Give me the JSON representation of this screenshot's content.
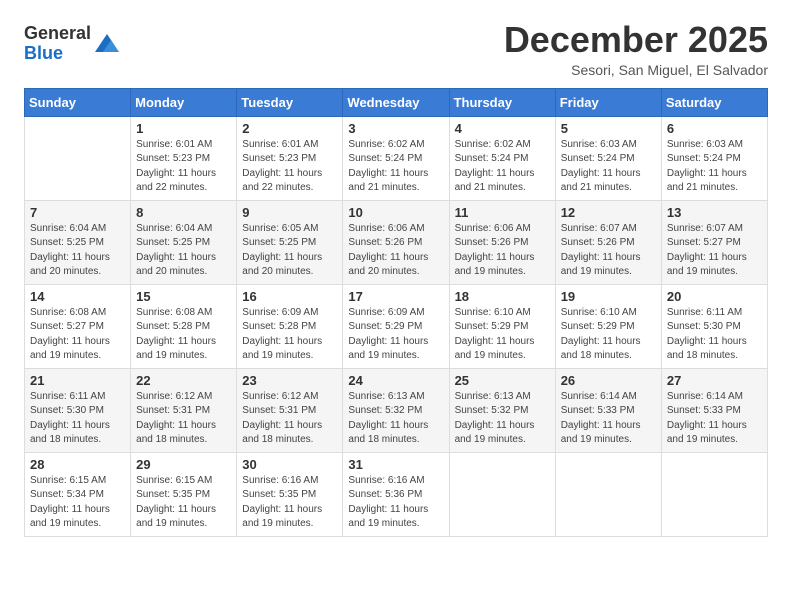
{
  "header": {
    "logo": {
      "line1": "General",
      "line2": "Blue"
    },
    "title": "December 2025",
    "subtitle": "Sesori, San Miguel, El Salvador"
  },
  "days_of_week": [
    "Sunday",
    "Monday",
    "Tuesday",
    "Wednesday",
    "Thursday",
    "Friday",
    "Saturday"
  ],
  "weeks": [
    [
      {
        "day": "",
        "info": ""
      },
      {
        "day": "1",
        "info": "Sunrise: 6:01 AM\nSunset: 5:23 PM\nDaylight: 11 hours\nand 22 minutes."
      },
      {
        "day": "2",
        "info": "Sunrise: 6:01 AM\nSunset: 5:23 PM\nDaylight: 11 hours\nand 22 minutes."
      },
      {
        "day": "3",
        "info": "Sunrise: 6:02 AM\nSunset: 5:24 PM\nDaylight: 11 hours\nand 21 minutes."
      },
      {
        "day": "4",
        "info": "Sunrise: 6:02 AM\nSunset: 5:24 PM\nDaylight: 11 hours\nand 21 minutes."
      },
      {
        "day": "5",
        "info": "Sunrise: 6:03 AM\nSunset: 5:24 PM\nDaylight: 11 hours\nand 21 minutes."
      },
      {
        "day": "6",
        "info": "Sunrise: 6:03 AM\nSunset: 5:24 PM\nDaylight: 11 hours\nand 21 minutes."
      }
    ],
    [
      {
        "day": "7",
        "info": "Sunrise: 6:04 AM\nSunset: 5:25 PM\nDaylight: 11 hours\nand 20 minutes."
      },
      {
        "day": "8",
        "info": "Sunrise: 6:04 AM\nSunset: 5:25 PM\nDaylight: 11 hours\nand 20 minutes."
      },
      {
        "day": "9",
        "info": "Sunrise: 6:05 AM\nSunset: 5:25 PM\nDaylight: 11 hours\nand 20 minutes."
      },
      {
        "day": "10",
        "info": "Sunrise: 6:06 AM\nSunset: 5:26 PM\nDaylight: 11 hours\nand 20 minutes."
      },
      {
        "day": "11",
        "info": "Sunrise: 6:06 AM\nSunset: 5:26 PM\nDaylight: 11 hours\nand 19 minutes."
      },
      {
        "day": "12",
        "info": "Sunrise: 6:07 AM\nSunset: 5:26 PM\nDaylight: 11 hours\nand 19 minutes."
      },
      {
        "day": "13",
        "info": "Sunrise: 6:07 AM\nSunset: 5:27 PM\nDaylight: 11 hours\nand 19 minutes."
      }
    ],
    [
      {
        "day": "14",
        "info": "Sunrise: 6:08 AM\nSunset: 5:27 PM\nDaylight: 11 hours\nand 19 minutes."
      },
      {
        "day": "15",
        "info": "Sunrise: 6:08 AM\nSunset: 5:28 PM\nDaylight: 11 hours\nand 19 minutes."
      },
      {
        "day": "16",
        "info": "Sunrise: 6:09 AM\nSunset: 5:28 PM\nDaylight: 11 hours\nand 19 minutes."
      },
      {
        "day": "17",
        "info": "Sunrise: 6:09 AM\nSunset: 5:29 PM\nDaylight: 11 hours\nand 19 minutes."
      },
      {
        "day": "18",
        "info": "Sunrise: 6:10 AM\nSunset: 5:29 PM\nDaylight: 11 hours\nand 19 minutes."
      },
      {
        "day": "19",
        "info": "Sunrise: 6:10 AM\nSunset: 5:29 PM\nDaylight: 11 hours\nand 18 minutes."
      },
      {
        "day": "20",
        "info": "Sunrise: 6:11 AM\nSunset: 5:30 PM\nDaylight: 11 hours\nand 18 minutes."
      }
    ],
    [
      {
        "day": "21",
        "info": "Sunrise: 6:11 AM\nSunset: 5:30 PM\nDaylight: 11 hours\nand 18 minutes."
      },
      {
        "day": "22",
        "info": "Sunrise: 6:12 AM\nSunset: 5:31 PM\nDaylight: 11 hours\nand 18 minutes."
      },
      {
        "day": "23",
        "info": "Sunrise: 6:12 AM\nSunset: 5:31 PM\nDaylight: 11 hours\nand 18 minutes."
      },
      {
        "day": "24",
        "info": "Sunrise: 6:13 AM\nSunset: 5:32 PM\nDaylight: 11 hours\nand 18 minutes."
      },
      {
        "day": "25",
        "info": "Sunrise: 6:13 AM\nSunset: 5:32 PM\nDaylight: 11 hours\nand 19 minutes."
      },
      {
        "day": "26",
        "info": "Sunrise: 6:14 AM\nSunset: 5:33 PM\nDaylight: 11 hours\nand 19 minutes."
      },
      {
        "day": "27",
        "info": "Sunrise: 6:14 AM\nSunset: 5:33 PM\nDaylight: 11 hours\nand 19 minutes."
      }
    ],
    [
      {
        "day": "28",
        "info": "Sunrise: 6:15 AM\nSunset: 5:34 PM\nDaylight: 11 hours\nand 19 minutes."
      },
      {
        "day": "29",
        "info": "Sunrise: 6:15 AM\nSunset: 5:35 PM\nDaylight: 11 hours\nand 19 minutes."
      },
      {
        "day": "30",
        "info": "Sunrise: 6:16 AM\nSunset: 5:35 PM\nDaylight: 11 hours\nand 19 minutes."
      },
      {
        "day": "31",
        "info": "Sunrise: 6:16 AM\nSunset: 5:36 PM\nDaylight: 11 hours\nand 19 minutes."
      },
      {
        "day": "",
        "info": ""
      },
      {
        "day": "",
        "info": ""
      },
      {
        "day": "",
        "info": ""
      }
    ]
  ]
}
